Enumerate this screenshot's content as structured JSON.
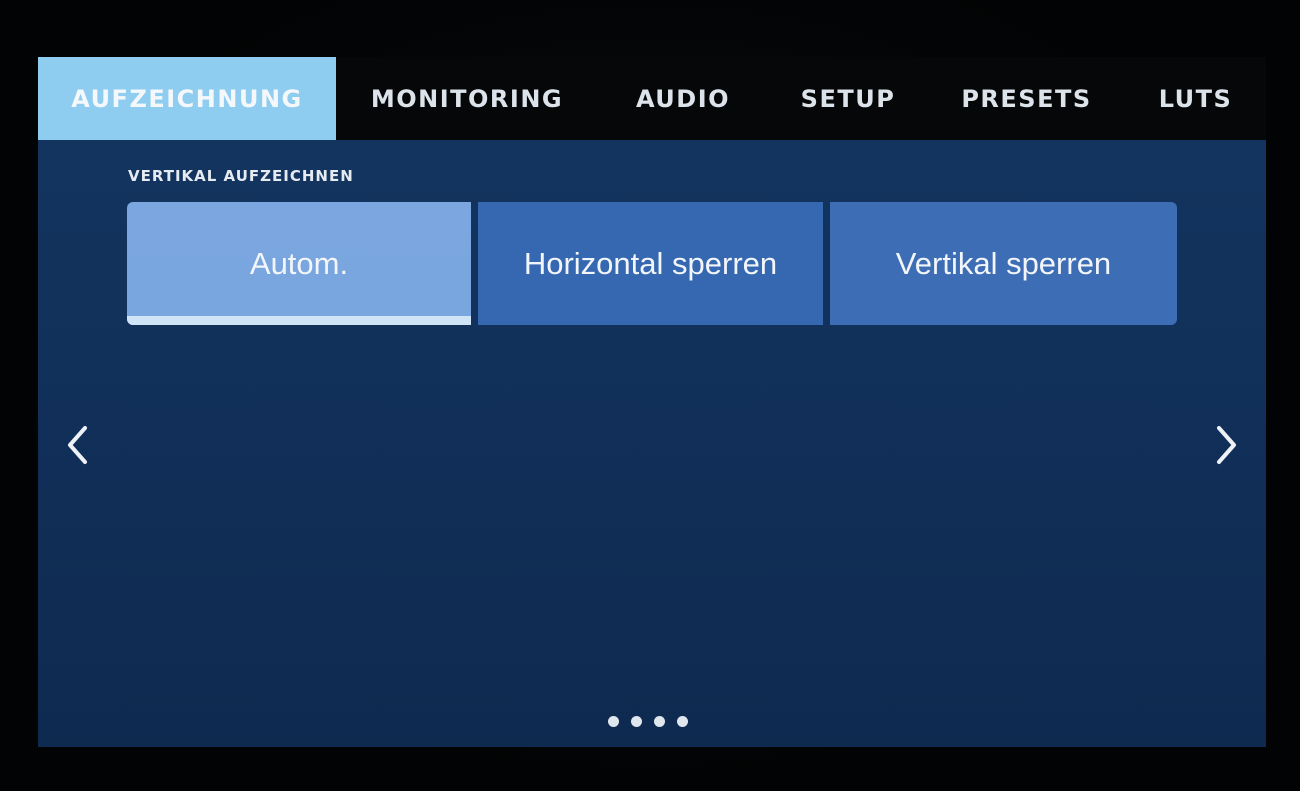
{
  "tabs": [
    {
      "label": "AUFZEICHNUNG",
      "active": true
    },
    {
      "label": "MONITORING",
      "active": false
    },
    {
      "label": "AUDIO",
      "active": false
    },
    {
      "label": "SETUP",
      "active": false
    },
    {
      "label": "PRESETS",
      "active": false
    },
    {
      "label": "LUTS",
      "active": false
    }
  ],
  "section": {
    "title": "VERTIKAL AUFZEICHNEN",
    "options": [
      {
        "label": "Autom.",
        "selected": true
      },
      {
        "label": "Horizontal sperren",
        "selected": false
      },
      {
        "label": "Vertikal sperren",
        "selected": false
      }
    ]
  },
  "navigation": {
    "prev_icon": "chevron-left-icon",
    "next_icon": "chevron-right-icon"
  },
  "pagination": {
    "page_count": 4
  },
  "colors": {
    "active_tab": "#8fcdf0",
    "selected_option": "#7aa6e0",
    "option": "#3568b1",
    "background": "#12325c"
  }
}
